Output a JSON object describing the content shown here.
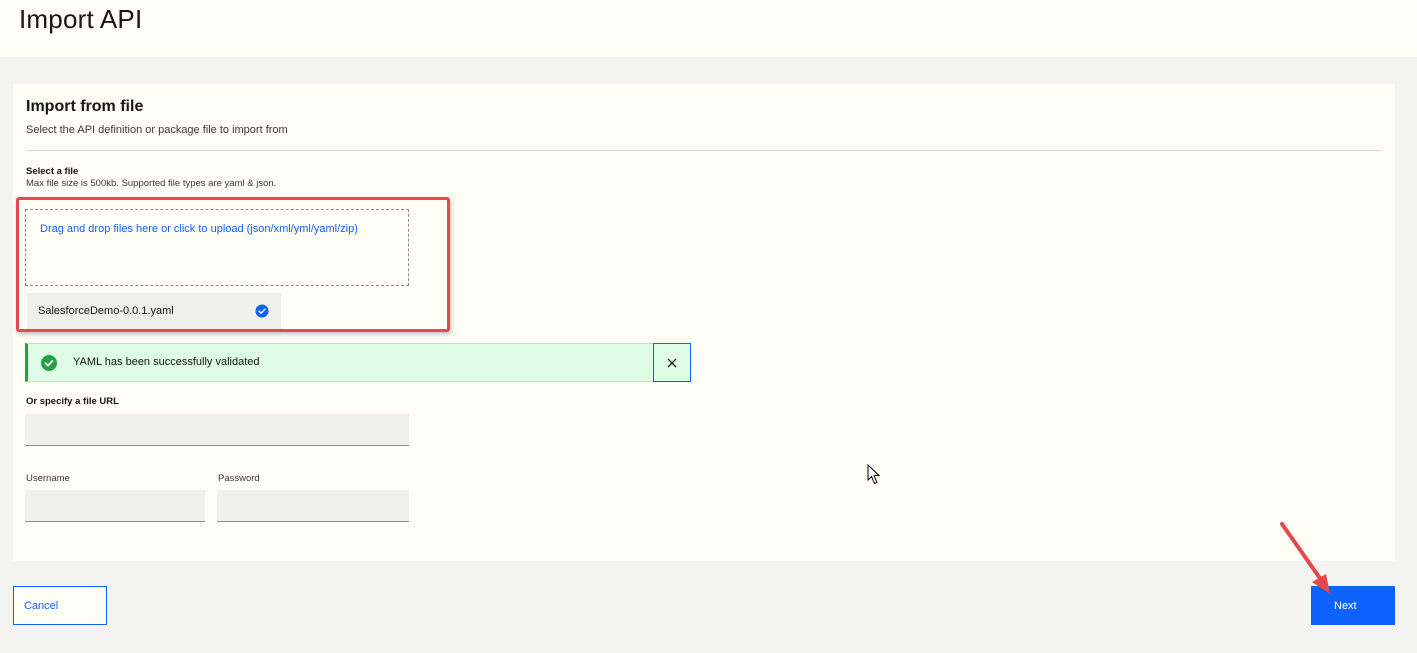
{
  "header": {
    "title": "Import API"
  },
  "section": {
    "title": "Import from file",
    "subtitle": "Select the API definition or package file to import from"
  },
  "file_select": {
    "label": "Select a file",
    "helper": "Max file size is 500kb. Supported file types are yaml & json.",
    "dropzone_text": "Drag and drop files here or click to upload (json/xml/yml/yaml/zip)",
    "selected_file": "SalesforceDemo-0.0.1.yaml",
    "file_status_icon": "check-circle-icon"
  },
  "notification": {
    "message": "YAML has been successfully validated",
    "type": "success",
    "icon": "checkmark-filled-icon",
    "close_icon": "close-icon"
  },
  "url_field": {
    "label": "Or specify a file URL",
    "value": ""
  },
  "credentials": {
    "username_label": "Username",
    "username_value": "",
    "password_label": "Password",
    "password_value": ""
  },
  "actions": {
    "cancel_label": "Cancel",
    "next_label": "Next"
  },
  "colors": {
    "accent": "#0f62fe",
    "success": "#24a148",
    "success_bg": "#defbe6",
    "annotation": "#e5484d"
  }
}
